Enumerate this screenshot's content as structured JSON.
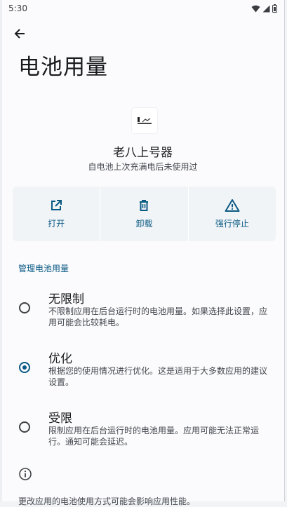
{
  "status_bar": {
    "time": "5:30"
  },
  "header": {
    "back_icon": "arrow-left-icon",
    "title": "电池用量"
  },
  "app": {
    "name": "老八上号器",
    "subtitle": "自电池上次充满电后未使用过"
  },
  "actions": [
    {
      "label": "打开",
      "icon": "open-external-icon"
    },
    {
      "label": "卸载",
      "icon": "trash-icon"
    },
    {
      "label": "强行停止",
      "icon": "warning-icon"
    }
  ],
  "section": {
    "title": "管理电池用量"
  },
  "options": [
    {
      "title": "无限制",
      "description": "不限制应用在后台运行时的电池用量。如果选择此设置，应用可能会比较耗电。",
      "selected": false
    },
    {
      "title": "优化",
      "description": "根据您的使用情况进行优化。这是适用于大多数应用的建议设置。",
      "selected": true
    },
    {
      "title": "受限",
      "description": "限制应用在后台运行时的电池用量。应用可能无法正常运行。通知可能会延迟。",
      "selected": false
    }
  ],
  "footer": {
    "icon": "info-icon",
    "text": "更改应用的电池使用方式可能会影响应用性能。"
  },
  "colors": {
    "accent": "#0b5a84",
    "background": "#fbfbfd",
    "action_bg": "#f1f4f7"
  }
}
